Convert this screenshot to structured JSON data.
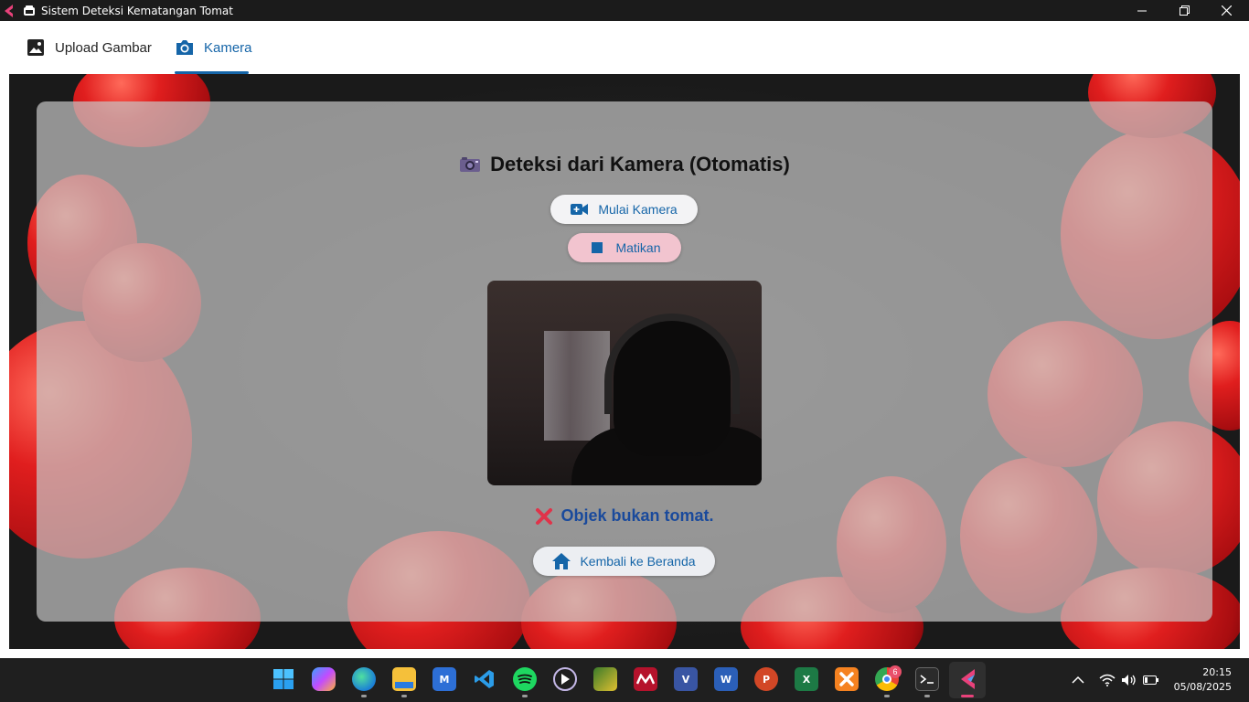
{
  "window": {
    "title": "Sistem Deteksi Kematangan Tomat"
  },
  "tabs": [
    {
      "label": "Upload Gambar",
      "icon": "image-icon",
      "active": false
    },
    {
      "label": "Kamera",
      "icon": "camera-icon",
      "active": true
    }
  ],
  "main": {
    "heading": "Deteksi dari Kamera (Otomatis)",
    "start_button": "Mulai Kamera",
    "stop_button": "Matikan",
    "result_text": "Objek bukan tomat.",
    "home_button": "Kembali ke Beranda"
  },
  "taskbar": {
    "apps": [
      "start",
      "copilot",
      "edge",
      "file-explorer",
      "visual-studio",
      "vscode",
      "spotify",
      "media-player",
      "photos",
      "mendeley",
      "visio",
      "word",
      "powerpoint",
      "excel",
      "xampp",
      "chrome",
      "terminal",
      "flutter-app"
    ],
    "chrome_badge": "6",
    "time": "20:15",
    "date": "05/08/2025"
  },
  "colors": {
    "accent": "#1565a8",
    "title_bar": "#1b1b1b",
    "taskbar": "#1f1f1f",
    "stop_button_bg": "#f2c4cf",
    "result_text": "#1a4a9c",
    "result_icon": "#e0334a"
  }
}
